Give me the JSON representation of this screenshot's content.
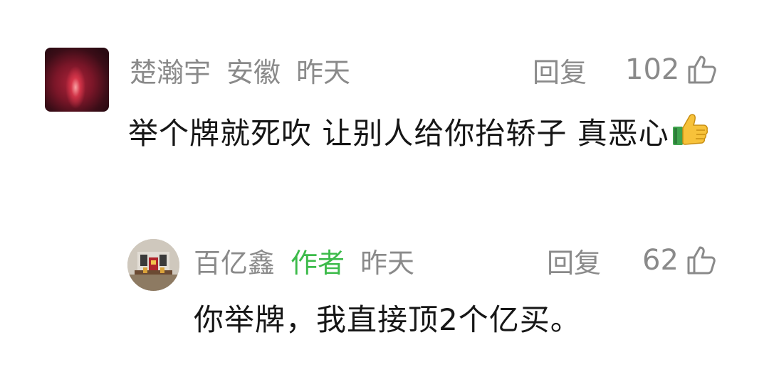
{
  "comment": {
    "username": "楚瀚宇",
    "location": "安徽",
    "time": "昨天",
    "reply_label": "回复",
    "like_count": "102",
    "text": "举个牌就死吹 让别人给你抬轿子 真恶心",
    "emoji": "thumbs-up-emoji"
  },
  "reply": {
    "username": "百亿鑫",
    "author_tag": "作者",
    "time": "昨天",
    "reply_label": "回复",
    "like_count": "62",
    "text": "你举牌，我直接顶2个亿买。"
  },
  "colors": {
    "meta_gray": "#8a8a8a",
    "author_green": "#3cbb4a",
    "text": "#161616"
  }
}
